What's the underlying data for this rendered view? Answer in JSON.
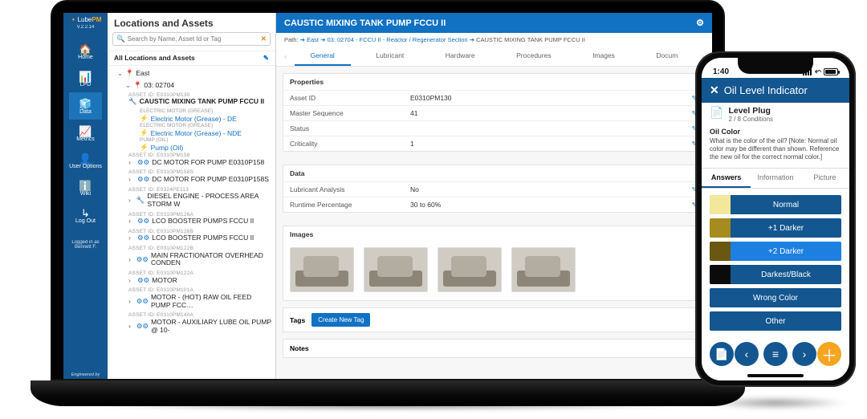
{
  "app": {
    "brand_prefix": "Lube",
    "brand_suffix": "PM",
    "version": "V.2.2.14"
  },
  "rail": {
    "items": [
      {
        "icon": "🏠",
        "label": "Home"
      },
      {
        "icon": "📊",
        "label": "LPD"
      },
      {
        "icon": "🧊",
        "label": "Data"
      },
      {
        "icon": "📈",
        "label": "Metrics"
      },
      {
        "icon": "👤",
        "label": "User Options"
      },
      {
        "icon": "ℹ️",
        "label": "Wiki"
      },
      {
        "icon": "↳",
        "label": "Log Out"
      }
    ],
    "selected_index": 2,
    "logged_in_label": "Logged in as",
    "logged_in_user": "Bennett F.",
    "engineered": "Engineered by"
  },
  "tree": {
    "title": "Locations and Assets",
    "search_placeholder": "Search by Name, Asset Id or Tag",
    "all_label": "All Locations and Assets",
    "root": {
      "label": "East"
    },
    "loc": {
      "label": "03: 02704"
    },
    "assets": [
      {
        "aid": "ASSET ID: E0310PM130",
        "name": "CAUSTIC MIXING TANK PUMP FCCU II",
        "icon": "wrench",
        "bold": true,
        "subs": [
          {
            "type": "ELECTRIC MOTOR (GREASE)",
            "name": "Electric Motor (Grease) - DE"
          },
          {
            "type": "ELECTRIC MOTOR (GREASE)",
            "name": "Electric Motor (Grease) - NDE"
          },
          {
            "type": "PUMP (OIL)",
            "name": "Pump (Oil)"
          }
        ]
      },
      {
        "aid": "ASSET ID: E0310PM158",
        "name": "DC MOTOR FOR PUMP E0310P158",
        "icon": "gears"
      },
      {
        "aid": "ASSET ID: E0310PM158S",
        "name": "DC MOTOR FOR PUMP E0310P158S",
        "icon": "gears"
      },
      {
        "aid": "ASSET ID: E0324PE113",
        "name": "DIESEL ENGINE - PROCESS AREA STORM W",
        "icon": "wrench"
      },
      {
        "aid": "ASSET ID: E0310PM126A",
        "name": "LCO BOOSTER PUMPS FCCU II",
        "icon": "gears"
      },
      {
        "aid": "ASSET ID: E0310PM126B",
        "name": "LCO BOOSTER PUMPS FCCU II",
        "icon": "gears"
      },
      {
        "aid": "ASSET ID: E0310PM122B",
        "name": "MAIN FRACTIONATOR OVERHEAD CONDEN",
        "icon": "gears"
      },
      {
        "aid": "ASSET ID: E0310PM122A",
        "name": "MOTOR",
        "icon": "gears"
      },
      {
        "aid": "ASSET ID: E0310PM101A",
        "name": "MOTOR - (HOT) RAW OIL FEED PUMP FCC…",
        "icon": "gears"
      },
      {
        "aid": "ASSET ID: E0310PM140A",
        "name": "MOTOR - AUXILIARY LUBE OIL PUMP @ 10-",
        "icon": "gears"
      }
    ]
  },
  "main": {
    "title": "CAUSTIC MIXING TANK PUMP FCCU II",
    "path_label": "Path:",
    "crumbs": [
      "East",
      "03: 02704 - FCCU II - Reactor / Regenerator Section",
      "CAUSTIC MIXING TANK PUMP FCCU II"
    ],
    "tabs": [
      "General",
      "Lubricant",
      "Hardware",
      "Procedures",
      "Images",
      "Docum"
    ],
    "active_tab": 0,
    "properties_header": "Properties",
    "properties": [
      {
        "k": "Asset ID",
        "v": "E0310PM130"
      },
      {
        "k": "Master Sequence",
        "v": "41"
      },
      {
        "k": "Status",
        "v": ""
      },
      {
        "k": "Criticality",
        "v": "1"
      }
    ],
    "data_header": "Data",
    "data_rows": [
      {
        "k": "Lubricant Analysis",
        "v": "No"
      },
      {
        "k": "Runtime Percentage",
        "v": "30 to 60%"
      }
    ],
    "images_header": "Images",
    "image_count": 4,
    "tags_label": "Tags",
    "create_tag": "Create New Tag",
    "notes_header": "Notes"
  },
  "phone": {
    "time": "1:40",
    "title": "Oil Level Indicator",
    "sub_title": "Level Plug",
    "sub_meta": "2 / 8 Conditions",
    "question_header": "Oil Color",
    "question_text": "What is the color of the oil? [Note: Normal oil color may be different than shown. Reference the new oil for the correct normal color.]",
    "tabs": [
      "Answers",
      "Information",
      "Picture"
    ],
    "active_tab": 0,
    "answers": [
      {
        "swatch": "#f3e79a",
        "label": "Normal"
      },
      {
        "swatch": "#a68b1f",
        "label": "+1 Darker"
      },
      {
        "swatch": "#6a5812",
        "label": "+2 Darker",
        "selected": true
      },
      {
        "swatch": "#0b0b0b",
        "label": "Darkest/Black"
      },
      {
        "swatch": null,
        "label": "Wrong Color"
      },
      {
        "swatch": null,
        "label": "Other"
      }
    ]
  }
}
